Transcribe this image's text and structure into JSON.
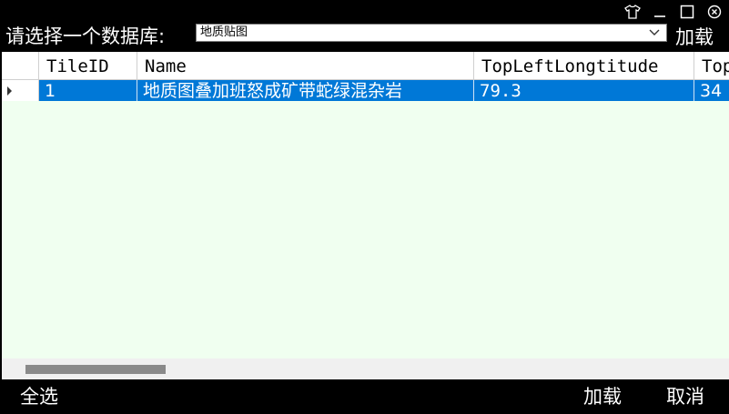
{
  "titlebar": {
    "icons": [
      "shirt-icon",
      "minimize-icon",
      "maximize-icon",
      "close-icon"
    ]
  },
  "toolbar": {
    "db_label": "请选择一个数据库:",
    "db_value": "地质贴图",
    "load_label": "加载"
  },
  "grid": {
    "columns": [
      "TileID",
      "Name",
      "TopLeftLongtitude",
      "Top"
    ],
    "rows": [
      {
        "cells": [
          "1",
          "地质图叠加班怒成矿带蛇绿混杂岩",
          "79.3",
          "34"
        ]
      }
    ],
    "selected_row": 0,
    "selection_color": "#0078d7",
    "background_color": "#f0fff0"
  },
  "footer": {
    "select_all_label": "全选",
    "load_label": "加载",
    "cancel_label": "取消"
  }
}
